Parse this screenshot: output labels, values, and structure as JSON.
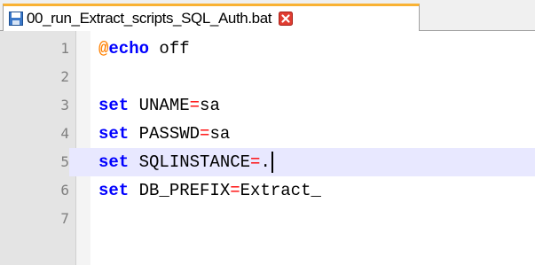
{
  "tab": {
    "label": "00_run_Extract_scripts_SQL_Auth.bat",
    "file_icon": "save-file-icon",
    "close_icon": "close-red-x-icon"
  },
  "colors": {
    "keyword": "#0000ff",
    "at_sign": "#ff8000",
    "operator": "#ff0000",
    "current_line": "#e8e8ff",
    "gutter": "#e4e4e4",
    "tab_accent": "#f9b233"
  },
  "lines": [
    {
      "number": "1",
      "at": "@",
      "keyword": "echo",
      "rest": " off",
      "op": "",
      "value": ""
    },
    {
      "number": "2",
      "at": "",
      "keyword": "",
      "rest": "",
      "op": "",
      "value": ""
    },
    {
      "number": "3",
      "at": "",
      "keyword": "set",
      "rest": " UNAME",
      "op": "=",
      "value": "sa"
    },
    {
      "number": "4",
      "at": "",
      "keyword": "set",
      "rest": " PASSWD",
      "op": "=",
      "value": "sa"
    },
    {
      "number": "5",
      "at": "",
      "keyword": "set",
      "rest": " SQLINSTANCE",
      "op": "=",
      "value": "."
    },
    {
      "number": "6",
      "at": "",
      "keyword": "set",
      "rest": " DB_PREFIX",
      "op": "=",
      "value": "Extract_"
    },
    {
      "number": "7",
      "at": "",
      "keyword": "",
      "rest": "",
      "op": "",
      "value": ""
    }
  ]
}
